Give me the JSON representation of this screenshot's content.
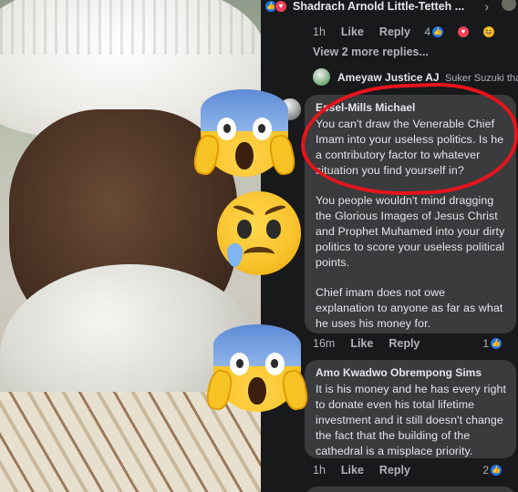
{
  "top_reply": {
    "author": "Shadrach Arnold Little-Tetteh ...",
    "time": "1h",
    "like_label": "Like",
    "reply_label": "Reply",
    "reaction_count": "4"
  },
  "view_more_label": "View 2 more replies...",
  "collapsed_reply": {
    "author": "Ameyaw Justice AJ",
    "preview": "Suker Suzuki that..."
  },
  "comments": [
    {
      "author": "Essel-Mills Michael",
      "paragraphs": [
        "You can't draw the Venerable Chief Imam into your useless politics. Is he a contributory factor to whatever situation you find yourself in?",
        "You people wouldn't mind dragging the Glorious Images of Jesus Christ and Prophet Muhamed into your dirty politics to score your useless political points.",
        "Chief imam does not owe explanation to anyone as far as what he uses his money for."
      ],
      "time": "16m",
      "like_label": "Like",
      "reply_label": "Reply",
      "reaction_count": "1"
    },
    {
      "author": "Amo Kwadwo Obrempong Sims",
      "paragraphs": [
        "It is his money and he has every right to donate even his total lifetime investment and it still doesn't change the fact that the building of the cathedral is a misplace priority."
      ],
      "time": "1h",
      "like_label": "Like",
      "reply_label": "Reply",
      "reaction_count": "2"
    }
  ],
  "icons": {
    "reactions": [
      "like-icon",
      "love-icon",
      "haha-icon"
    ],
    "emojis": [
      "screaming-face-emoji",
      "sad-but-relieved-face-emoji",
      "screaming-face-emoji"
    ]
  },
  "colors": {
    "panel_bg": "#18191a",
    "bubble_bg": "#3a3b3c",
    "like_blue": "#1877f2",
    "love_red": "#f33e58",
    "annotation_red": "#e8141c"
  }
}
